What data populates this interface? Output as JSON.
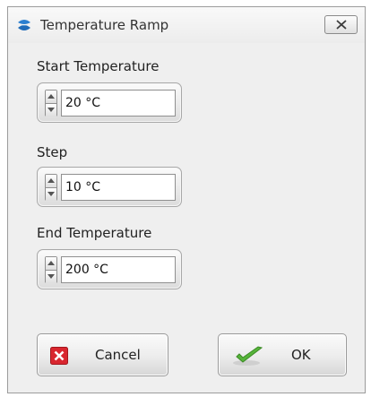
{
  "window": {
    "title": "Temperature Ramp"
  },
  "fields": {
    "start": {
      "label": "Start Temperature",
      "value": "20 °C"
    },
    "step": {
      "label": "Step",
      "value": "10 °C"
    },
    "end": {
      "label": "End Temperature",
      "value": "200 °C"
    }
  },
  "buttons": {
    "cancel": {
      "label": "Cancel",
      "icon": "red-x-icon"
    },
    "ok": {
      "label": "OK",
      "icon": "green-check-icon"
    }
  },
  "colors": {
    "accent_blue": "#2a7fd0",
    "cancel_red": "#d9262f",
    "ok_green": "#56b43a"
  }
}
